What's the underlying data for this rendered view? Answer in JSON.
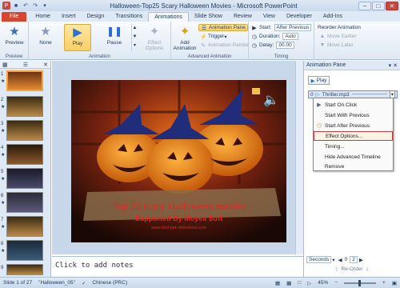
{
  "window": {
    "title": "Halloween-Top25 Scary Halloween Movies - Microsoft PowerPoint"
  },
  "tabs": [
    "File",
    "Home",
    "Insert",
    "Design",
    "Transitions",
    "Animations",
    "Slide Show",
    "Review",
    "View",
    "Developer",
    "Add-Ins"
  ],
  "ribbon": {
    "preview_label": "Preview",
    "preview_group": "Preview",
    "anim_none": "None",
    "anim_play": "Play",
    "anim_pause": "Pause",
    "effect_options": "Effect Options",
    "animation_group": "Animation",
    "add_animation": "Add Animation",
    "animation_pane": "Animation Pane",
    "trigger": "Trigger",
    "animation_painter": "Animation Painter",
    "advanced_group": "Advanced Animation",
    "start_label": "Start:",
    "start_value": "After Previous",
    "duration_label": "Duration:",
    "duration_value": "Auto",
    "delay_label": "Delay:",
    "delay_value": "00.00",
    "timing_group": "Timing",
    "reorder_label": "Reorder Animation",
    "move_earlier": "Move Earlier",
    "move_later": "Move Later"
  },
  "thumbs": [
    {
      "n": "1"
    },
    {
      "n": "2"
    },
    {
      "n": "3"
    },
    {
      "n": "4"
    },
    {
      "n": "5"
    },
    {
      "n": "6"
    },
    {
      "n": "7"
    },
    {
      "n": "8"
    },
    {
      "n": "9"
    }
  ],
  "slide": {
    "title": "Top 25 scary Halloween movies",
    "subtitle": "Supported By Moyea Soft",
    "url": "www.dvd-ppt-slideshow.com"
  },
  "notes": "Click to add notes",
  "pane": {
    "title": "Animation Pane",
    "play": "Play",
    "effect": {
      "index": "0",
      "name": "Thriller.mp3"
    },
    "menu": [
      "Start On Click",
      "Start With Previous",
      "Start After Previous",
      "Effect Options...",
      "Timing...",
      "Hide Advanced Timeline",
      "Remove"
    ],
    "seconds": "Seconds",
    "page_from": "0",
    "page_to": "2",
    "reorder": "Re-Order"
  },
  "status": {
    "slide": "Slide 1 of 27",
    "theme": "\"Halloween_05\"",
    "language": "Chinese (PRC)",
    "zoom": "45%"
  },
  "colors": {
    "accent": "#f9cf63",
    "file_tab": "#d6452f",
    "highlight_border": "#c13e3e"
  }
}
